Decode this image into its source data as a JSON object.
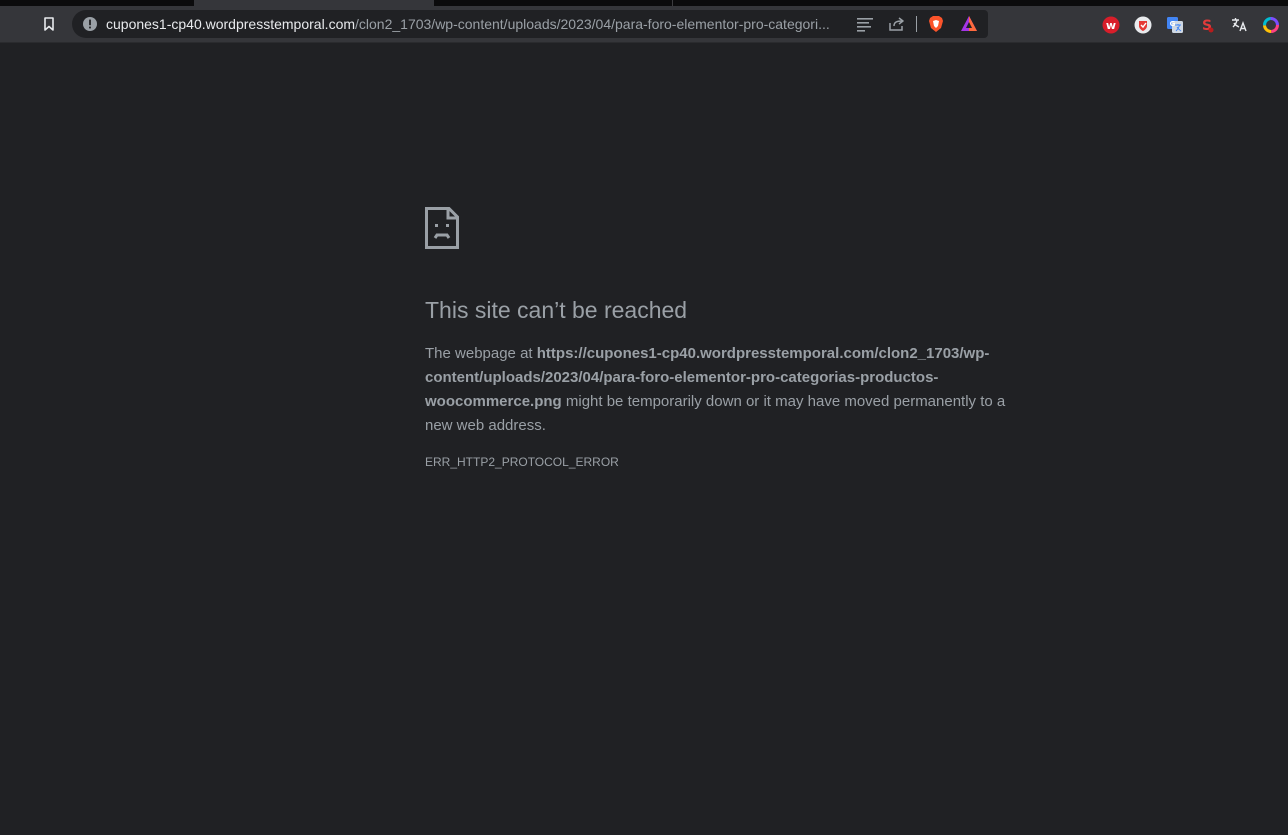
{
  "browser": {
    "address_bar": {
      "host": "cupones1-cp40.wordpresstemporal.com",
      "path": "/clon2_1703/wp-content/uploads/2023/04/para-foro-elementor-pro-categori..."
    },
    "extensions": [
      "wappalyzer-icon",
      "adblock-icon",
      "google-translate-icon",
      "s-extension-icon",
      "translate-icon",
      "colorful-ring-icon"
    ]
  },
  "error_page": {
    "title": "This site can’t be reached",
    "message_prefix": "The webpage at ",
    "message_url": "https://cupones1-cp40.wordpresstemporal.com/clon2_1703/wp-content/uploads/2023/04/para-foro-elementor-pro-categorias-productos-woocommerce.png",
    "message_suffix": " might be temporarily down or it may have moved permanently to a new web address.",
    "error_code": "ERR_HTTP2_PROTOCOL_ERROR"
  },
  "colors": {
    "page_background": "#202124",
    "toolbar_background": "#35363a",
    "text_muted": "#9aa0a6",
    "brave_orange": "#fb542b"
  }
}
